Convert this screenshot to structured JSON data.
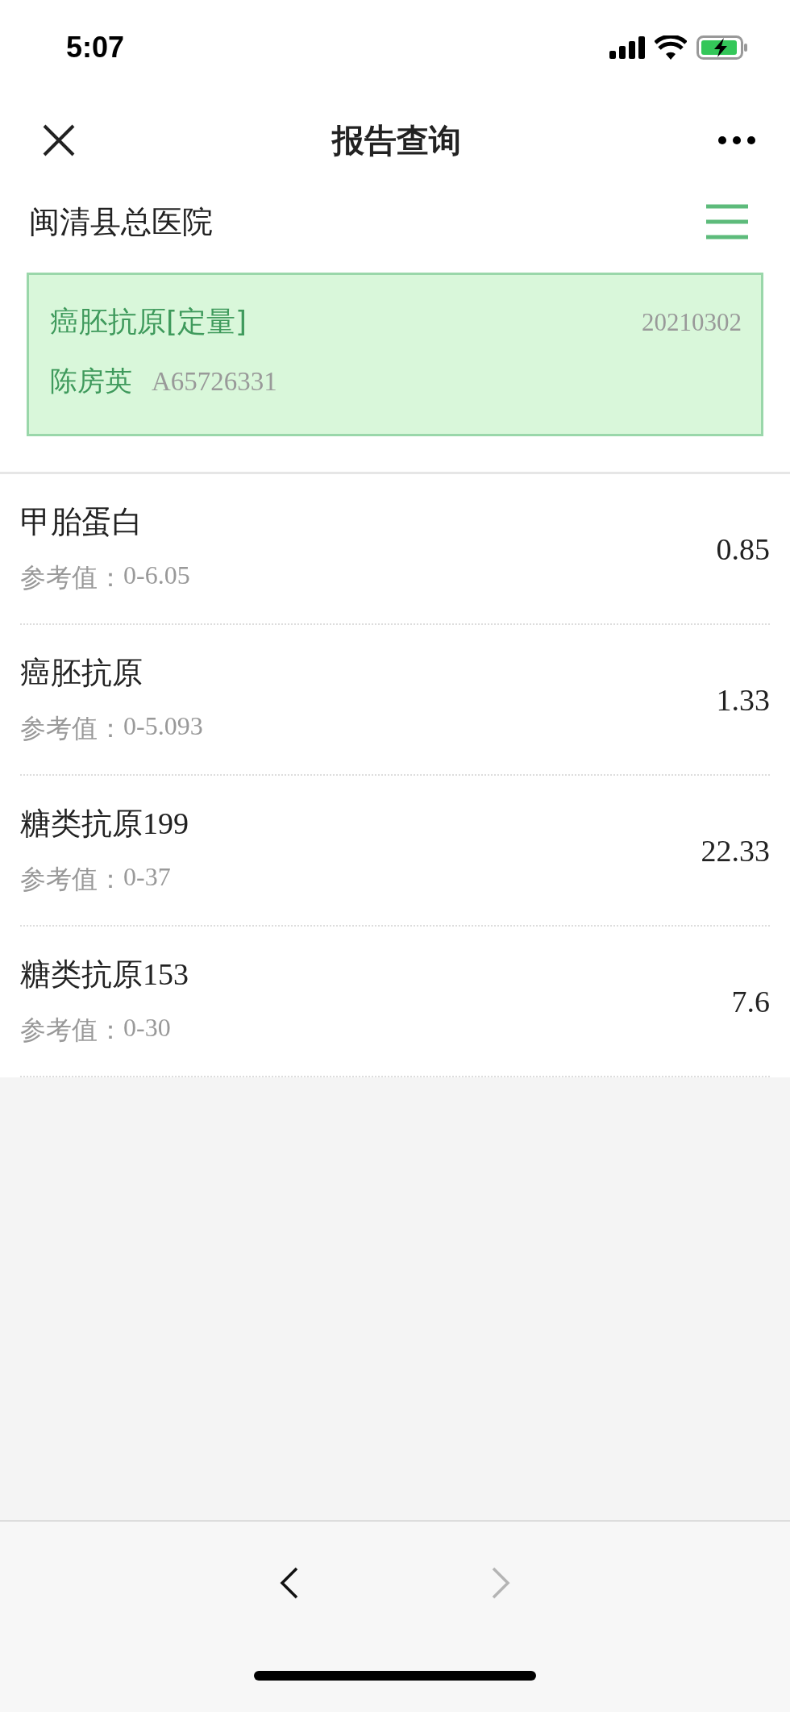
{
  "status_bar": {
    "time": "5:07"
  },
  "nav_bar": {
    "title": "报告查询"
  },
  "hospital": {
    "name": "闽清县总医院"
  },
  "report": {
    "title": "癌胚抗原[定量]",
    "date": "20210302",
    "patient": "陈房英",
    "patient_id": "A65726331",
    "selected": true
  },
  "results": [
    {
      "name": "甲胎蛋白",
      "reference_label": "参考值：",
      "reference": "0-6.05",
      "value": "0.85"
    },
    {
      "name": "癌胚抗原",
      "reference_label": "参考值：",
      "reference": "0-5.093",
      "value": "1.33"
    },
    {
      "name": "糖类抗原199",
      "reference_label": "参考值：",
      "reference": "0-37",
      "value": "22.33"
    },
    {
      "name": "糖类抗原153",
      "reference_label": "参考值：",
      "reference": "0-30",
      "value": "7.6"
    }
  ],
  "toolbar": {
    "back": {
      "disabled": false
    },
    "forward": {
      "disabled": true
    }
  }
}
